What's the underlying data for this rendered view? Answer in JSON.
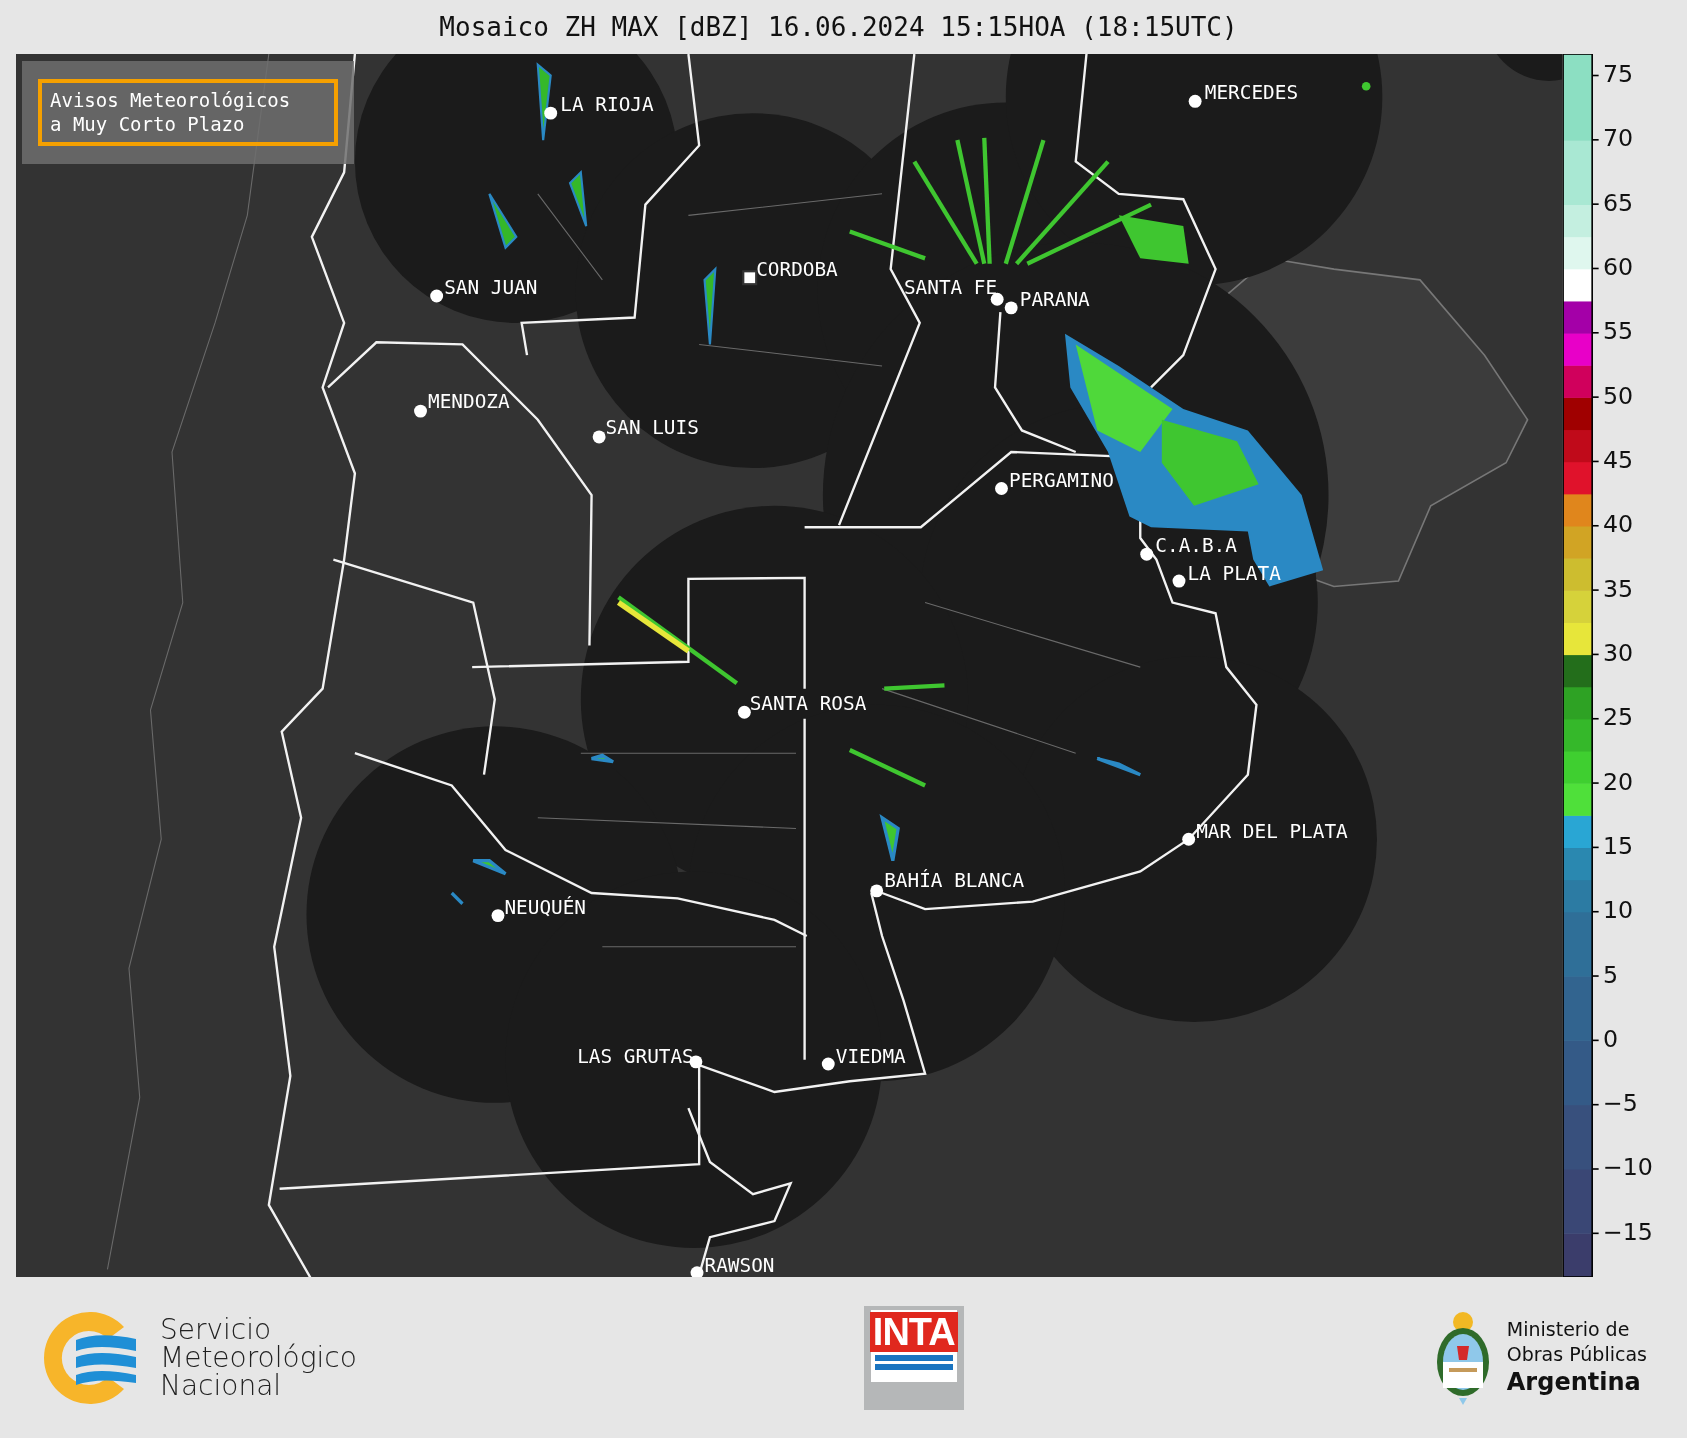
{
  "title": "Mosaico ZH MAX [dBZ] 16.06.2024 15:15HOA (18:15UTC)",
  "notice": {
    "lines": [
      "Avisos Meteorológicos",
      "a Muy Corto Plazo"
    ]
  },
  "cities": [
    {
      "name": "LA RIOJA",
      "kind": "dot"
    },
    {
      "name": "MERCEDES",
      "kind": "dot"
    },
    {
      "name": "CORDOBA",
      "kind": "square"
    },
    {
      "name": "SAN JUAN",
      "kind": "dot"
    },
    {
      "name": "SANTA FE",
      "kind": "dot"
    },
    {
      "name": "PARANA",
      "kind": "dot"
    },
    {
      "name": "MENDOZA",
      "kind": "dot"
    },
    {
      "name": "SAN LUIS",
      "kind": "dot"
    },
    {
      "name": "PERGAMINO",
      "kind": "dot"
    },
    {
      "name": "C.A.B.A",
      "kind": "dot"
    },
    {
      "name": "LA PLATA",
      "kind": "dot"
    },
    {
      "name": "SANTA ROSA",
      "kind": "dot"
    },
    {
      "name": "MAR DEL PLATA",
      "kind": "dot"
    },
    {
      "name": "BAHÍA BLANCA",
      "kind": "dot"
    },
    {
      "name": "NEUQUÉN",
      "kind": "dot"
    },
    {
      "name": "LAS GRUTAS",
      "kind": "dot"
    },
    {
      "name": "VIEDMA",
      "kind": "dot"
    },
    {
      "name": "RAWSON",
      "kind": "dot"
    }
  ],
  "colorbar": {
    "ticks": [
      "75",
      "70",
      "65",
      "60",
      "55",
      "50",
      "45",
      "40",
      "35",
      "30",
      "25",
      "20",
      "15",
      "10",
      "5",
      "0",
      "−5",
      "−10",
      "−15"
    ]
  },
  "footer": {
    "smn": [
      "Servicio",
      "Meteorológico",
      "Nacional"
    ],
    "inta": "INTA",
    "ministry": [
      "Ministerio de",
      "Obras Públicas",
      "Argentina"
    ]
  }
}
